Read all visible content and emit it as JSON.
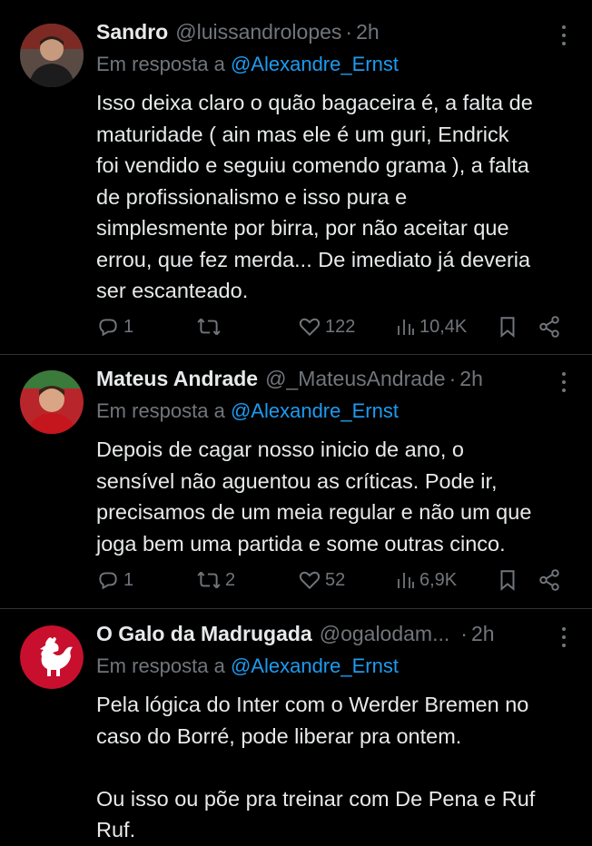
{
  "tweets": [
    {
      "name": "Sandro",
      "handle": "@luissandrolopes",
      "dot": "·",
      "time": "2h",
      "reply_prefix": "Em resposta a",
      "reply_to": "@Alexandre_Ernst",
      "text_lines": [
        "Isso deixa claro o quão bagaceira é, a falta de",
        "maturidade ( ain mas ele é um guri, Endrick",
        "foi vendido e seguiu comendo grama ), a falta",
        "de profissionalismo e isso pura e",
        "simplesmente por birra, por não aceitar que",
        "errou, que fez merda... De imediato já deveria",
        "ser escanteado."
      ],
      "replies": "1",
      "retweets": "",
      "likes": "122",
      "views": "10,4K"
    },
    {
      "name": "Mateus Andrade",
      "handle": "@_MateusAndrade",
      "dot": "·",
      "time": "2h",
      "reply_prefix": "Em resposta a",
      "reply_to": "@Alexandre_Ernst",
      "text_lines": [
        "Depois de cagar nosso inicio de ano, o",
        "sensível não aguentou as críticas. Pode ir,",
        "precisamos de um meia regular e não um que",
        "joga bem uma partida e some outras cinco."
      ],
      "replies": "1",
      "retweets": "2",
      "likes": "52",
      "views": "6,9K"
    },
    {
      "name": "O Galo da Madrugada",
      "handle": "@ogalodam...",
      "dot": "·",
      "time": "2h",
      "reply_prefix": "Em resposta a",
      "reply_to": "@Alexandre_Ernst",
      "text_lines": [
        "Pela lógica do Inter com o Werder Bremen no",
        "caso do Borré, pode liberar pra ontem.",
        "",
        "Ou isso ou põe pra treinar com De Pena e Ruf",
        "Ruf."
      ]
    }
  ],
  "colors": {
    "background": "#000000",
    "text": "#e7e9ea",
    "muted": "#71767b",
    "link": "#1d9bf0",
    "galo_red": "#c8102e"
  },
  "icons": [
    "reply-icon",
    "retweet-icon",
    "like-icon",
    "views-icon",
    "bookmark-icon",
    "share-icon",
    "more-icon"
  ]
}
